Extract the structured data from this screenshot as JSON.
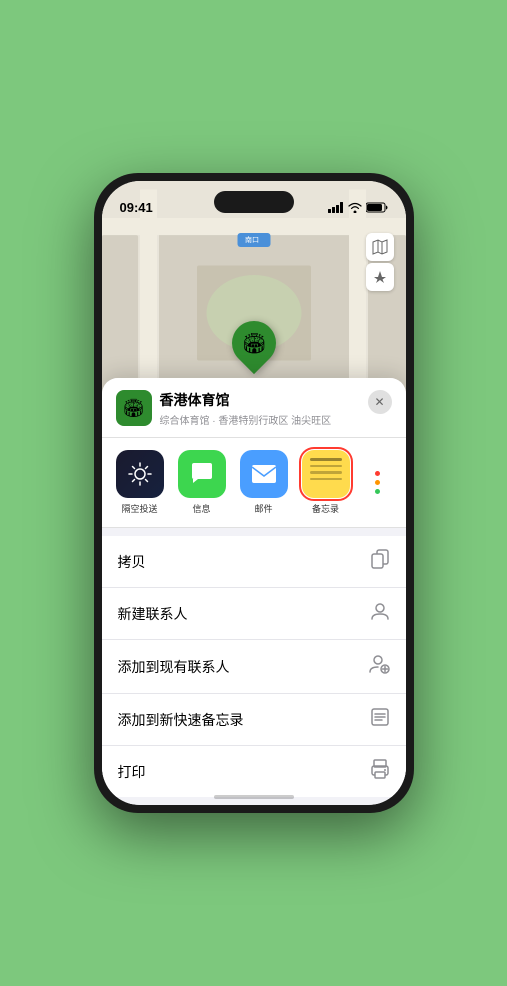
{
  "status": {
    "time": "09:41",
    "location_icon": "▶"
  },
  "map": {
    "label": "南口",
    "stadium_name": "香港体育馆",
    "controls": {
      "map_icon": "🗺",
      "location_icon": "↑"
    }
  },
  "venue_header": {
    "name": "香港体育馆",
    "subtitle": "综合体育馆 · 香港特别行政区 油尖旺区",
    "close_label": "✕"
  },
  "share_items": [
    {
      "id": "airdrop",
      "label": "隔空投送",
      "type": "airdrop"
    },
    {
      "id": "messages",
      "label": "信息",
      "type": "messages"
    },
    {
      "id": "mail",
      "label": "邮件",
      "type": "mail"
    },
    {
      "id": "notes",
      "label": "备忘录",
      "type": "notes"
    }
  ],
  "actions": [
    {
      "id": "copy",
      "label": "拷贝",
      "icon": "⎘"
    },
    {
      "id": "new-contact",
      "label": "新建联系人",
      "icon": "👤"
    },
    {
      "id": "add-existing",
      "label": "添加到现有联系人",
      "icon": "👤"
    },
    {
      "id": "add-notes",
      "label": "添加到新快速备忘录",
      "icon": "⊞"
    },
    {
      "id": "print",
      "label": "打印",
      "icon": "🖨"
    }
  ]
}
